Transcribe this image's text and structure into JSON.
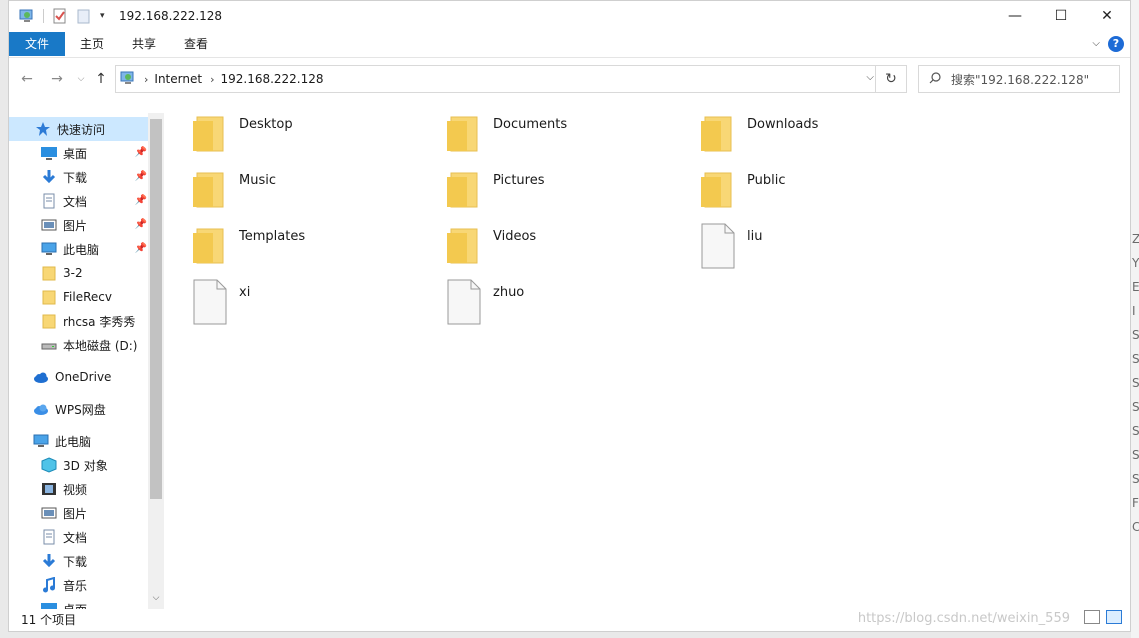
{
  "window": {
    "title": "192.168.222.128"
  },
  "ribbon": {
    "tabs": [
      "文件",
      "主页",
      "共享",
      "查看"
    ]
  },
  "address": {
    "crumbs": [
      "Internet",
      "192.168.222.128"
    ],
    "search_placeholder": "搜索\"192.168.222.128\""
  },
  "sidebar": {
    "quick_access": "快速访问",
    "pinned": [
      {
        "label": "桌面",
        "icon": "desktop-icon"
      },
      {
        "label": "下载",
        "icon": "download-icon"
      },
      {
        "label": "文档",
        "icon": "document-icon"
      },
      {
        "label": "图片",
        "icon": "pictures-icon"
      },
      {
        "label": "此电脑",
        "icon": "computer-icon"
      }
    ],
    "recent": [
      {
        "label": "3-2",
        "icon": "folder-icon"
      },
      {
        "label": "FileRecv",
        "icon": "folder-icon"
      },
      {
        "label": "rhcsa 李秀秀",
        "icon": "folder-icon"
      },
      {
        "label": "本地磁盘 (D:)",
        "icon": "drive-icon"
      }
    ],
    "onedrive": "OneDrive",
    "wps": "WPS网盘",
    "this_pc": "此电脑",
    "pc_items": [
      {
        "label": "3D 对象",
        "icon": "cube-icon"
      },
      {
        "label": "视频",
        "icon": "video-icon"
      },
      {
        "label": "图片",
        "icon": "pictures-icon"
      },
      {
        "label": "文档",
        "icon": "document-icon"
      },
      {
        "label": "下载",
        "icon": "download-icon"
      },
      {
        "label": "音乐",
        "icon": "music-icon"
      },
      {
        "label": "桌面",
        "icon": "desktop-icon"
      }
    ]
  },
  "files": [
    {
      "name": "Desktop",
      "type": "folder"
    },
    {
      "name": "Documents",
      "type": "folder"
    },
    {
      "name": "Downloads",
      "type": "folder"
    },
    {
      "name": "Music",
      "type": "folder"
    },
    {
      "name": "Pictures",
      "type": "folder"
    },
    {
      "name": "Public",
      "type": "folder"
    },
    {
      "name": "Templates",
      "type": "folder"
    },
    {
      "name": "Videos",
      "type": "folder"
    },
    {
      "name": "liu",
      "type": "file"
    },
    {
      "name": "xi",
      "type": "file"
    },
    {
      "name": "zhuo",
      "type": "file"
    }
  ],
  "status": {
    "count": "11 个项目",
    "watermark": "https://blog.csdn.net/weixin_559"
  },
  "colors": {
    "accent": "#1979c7",
    "selected": "#cce8ff",
    "folder": "#f8d775"
  }
}
